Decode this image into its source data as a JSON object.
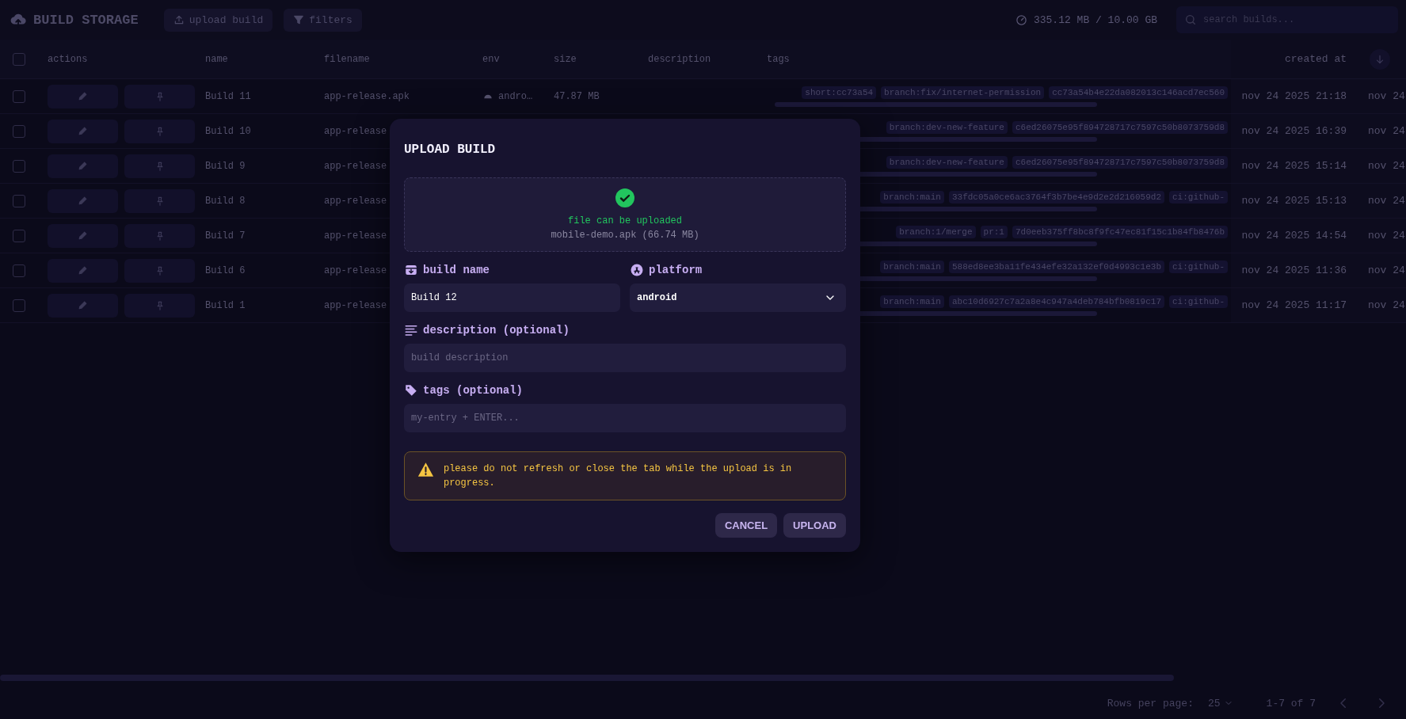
{
  "header": {
    "title": "BUILD STORAGE",
    "buttons": [
      "upload build",
      "filters"
    ],
    "storage": "335.12 MB / 10.00 GB",
    "search": {
      "placeholder": "search builds..."
    }
  },
  "table": {
    "all_checked": false,
    "columns": [
      "actions",
      "name",
      "filename",
      "env",
      "size",
      "description",
      "tags",
      "created at"
    ],
    "rows": [
      {
        "checked": false,
        "name": "Build 11",
        "filename": "app-release.apk",
        "env": "andro…",
        "size": "47.87 MB",
        "tags": [
          "short:cc73a54",
          "branch:fix/internet-permission",
          "cc73a54b4e22da082013c146acd7ec560"
        ],
        "created_at": "nov 24 2025 21:18",
        "column_10": "nov 24"
      },
      {
        "checked": false,
        "name": "Build 10",
        "filename": "app-release",
        "tags": [
          "branch:dev-new-feature",
          "c6ed26075e95f894728717c7597c50b8073759d8"
        ],
        "created_at": "nov 24 2025 16:39",
        "column_10": "nov 24"
      },
      {
        "checked": false,
        "name": "Build 9",
        "filename": "app-release",
        "tags": [
          "branch:dev-new-feature",
          "c6ed26075e95f894728717c7597c50b8073759d8"
        ],
        "created_at": "nov 24 2025 15:14",
        "column_10": "nov 24"
      },
      {
        "checked": false,
        "name": "Build 8",
        "filename": "app-release",
        "tags": [
          "branch:main",
          "33fdc05a0ce6ac3764f3b7be4e9d2e2d216059d2",
          "ci:github-"
        ],
        "created_at": "nov 24 2025 15:13",
        "column_10": "nov 24"
      },
      {
        "checked": false,
        "name": "Build 7",
        "filename": "app-release",
        "tags": [
          "branch:1/merge",
          "pr:1",
          "7d0eeb375ff8bc8f9fc47ec81f15c1b84fb8476b"
        ],
        "created_at": "nov 24 2025 14:54",
        "column_10": "nov 24"
      },
      {
        "checked": false,
        "name": "Build 6",
        "filename": "app-release",
        "tags": [
          "branch:main",
          "588ed8ee3ba11fe434efe32a132ef0d4993c1e3b",
          "ci:github-"
        ],
        "created_at": "nov 24 2025 11:36",
        "column_10": "nov 24"
      },
      {
        "checked": false,
        "name": "Build 1",
        "filename": "app-release",
        "tags": [
          "branch:main",
          "abc10d6927c7a2a8e4c947a4deb784bfb0819c17",
          "ci:github-"
        ],
        "created_at": "nov 24 2025 11:17",
        "column_10": "nov 24"
      }
    ]
  },
  "pagination": {
    "rows_per_page_label": "Rows per page:",
    "rows_per_page": "25",
    "range": "1-7 of 7"
  },
  "dialog": {
    "title": "UPLOAD BUILD",
    "dropzone": {
      "status": "file can be uploaded",
      "file": "mobile-demo.apk (66.74 MB)"
    },
    "fields": [
      {
        "kind": "text",
        "label": "build name",
        "value": "Build 12"
      },
      {
        "kind": "select",
        "label": "platform",
        "value": "android"
      },
      {
        "kind": "text",
        "label": "description (optional)",
        "placeholder": "build description"
      },
      {
        "kind": "text",
        "label": "tags (optional)",
        "placeholder": "my-entry + ENTER..."
      }
    ],
    "warning": "please do not refresh or close the tab while the upload is in progress.",
    "buttons": [
      "CANCEL",
      "UPLOAD"
    ]
  }
}
